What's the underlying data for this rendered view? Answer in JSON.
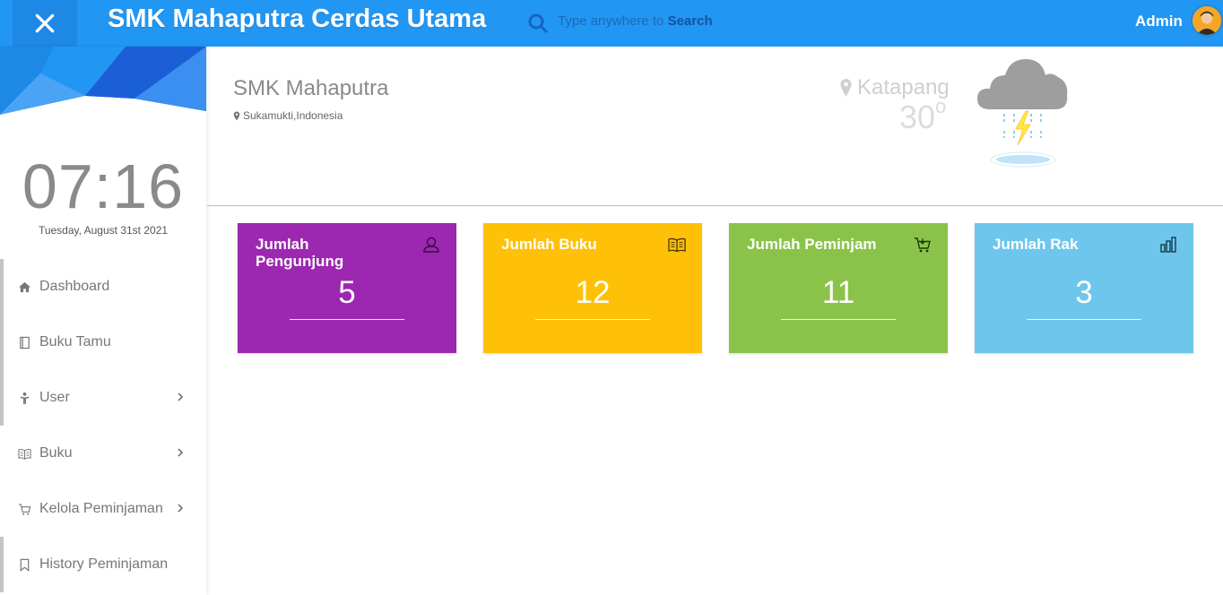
{
  "header": {
    "title": "SMK Mahaputra Cerdas Utama",
    "search_prefix": "Type anywhere to",
    "search_keyword": "Search",
    "user_name": "Admin"
  },
  "sidebar": {
    "time": "07:16",
    "date": "Tuesday, August 31st 2021",
    "items": [
      {
        "label": "Dashboard",
        "icon": "home-icon",
        "has_submenu": false
      },
      {
        "label": "Buku Tamu",
        "icon": "notebook-icon",
        "has_submenu": false
      },
      {
        "label": "User",
        "icon": "person-icon",
        "has_submenu": true
      },
      {
        "label": "Buku",
        "icon": "book-icon",
        "has_submenu": true
      },
      {
        "label": "Kelola Peminjaman",
        "icon": "cart-icon",
        "has_submenu": true
      },
      {
        "label": "History Peminjaman",
        "icon": "bookmark-icon",
        "has_submenu": false
      }
    ]
  },
  "school": {
    "name": "SMK Mahaputra",
    "location": "Sukamukti,Indonesia"
  },
  "weather": {
    "city": "Katapang",
    "temperature": "30",
    "degree": "o",
    "icon": "thunderstorm-cloud-icon"
  },
  "cards": [
    {
      "title": "Jumlah Pengunjung",
      "value": "5",
      "icon": "user-icon",
      "color": "#9c27b0"
    },
    {
      "title": "Jumlah Buku",
      "value": "12",
      "icon": "book-icon",
      "color": "#ffc107"
    },
    {
      "title": "Jumlah Peminjam",
      "value": "11",
      "icon": "cart-icon",
      "color": "#8bc34a"
    },
    {
      "title": "Jumlah Rak",
      "value": "3",
      "icon": "bar-chart-icon",
      "color": "#6ec6ed"
    }
  ],
  "colors": {
    "topbar": "#2196f3",
    "accent_dark": "#1565c0"
  }
}
